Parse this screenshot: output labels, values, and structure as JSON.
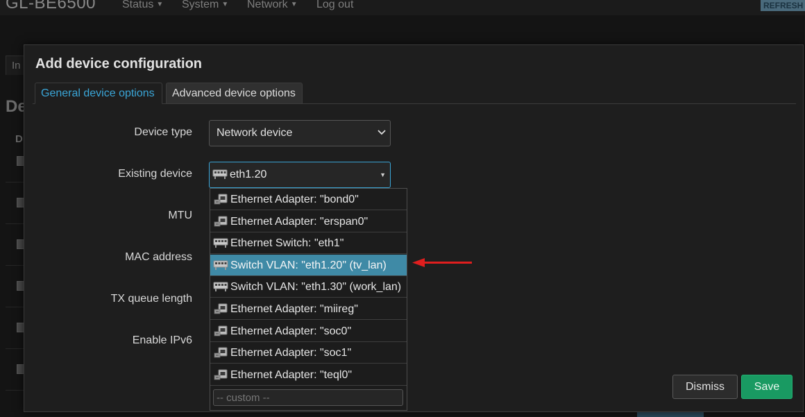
{
  "app": {
    "brand": "GL-BE6500",
    "nav": [
      "Status",
      "System",
      "Network",
      "Log out"
    ],
    "refresh_label": "REFRESH"
  },
  "background": {
    "tab_fragment": "In",
    "title_fragment": "De",
    "column_fragment": "D"
  },
  "modal": {
    "title": "Add device configuration",
    "tabs": [
      {
        "label": "General device options",
        "active": true
      },
      {
        "label": "Advanced device options",
        "active": false
      }
    ],
    "fields": {
      "device_type": {
        "label": "Device type",
        "value": "Network device"
      },
      "existing_device": {
        "label": "Existing device",
        "value": "eth1.20"
      },
      "mtu": {
        "label": "MTU"
      },
      "mac_address": {
        "label": "MAC address"
      },
      "tx_queue_length": {
        "label": "TX queue length"
      },
      "enable_ipv6": {
        "label": "Enable IPv6"
      }
    },
    "dropdown": {
      "items": [
        {
          "label": "Ethernet Adapter: \"bond0\"",
          "icon": "ethernet-adapter-icon"
        },
        {
          "label": "Ethernet Adapter: \"erspan0\"",
          "icon": "ethernet-adapter-icon"
        },
        {
          "label": "Ethernet Switch: \"eth1\"",
          "icon": "switch-icon"
        },
        {
          "label": "Switch VLAN: \"eth1.20\" (tv_lan)",
          "icon": "switch-icon",
          "selected": true
        },
        {
          "label": "Switch VLAN: \"eth1.30\" (work_lan)",
          "icon": "switch-icon"
        },
        {
          "label": "Ethernet Adapter: \"miireg\"",
          "icon": "ethernet-adapter-icon"
        },
        {
          "label": "Ethernet Adapter: \"soc0\"",
          "icon": "ethernet-adapter-icon"
        },
        {
          "label": "Ethernet Adapter: \"soc1\"",
          "icon": "ethernet-adapter-icon"
        },
        {
          "label": "Ethernet Adapter: \"teql0\"",
          "icon": "ethernet-adapter-icon"
        }
      ],
      "custom_placeholder": "-- custom --"
    },
    "buttons": {
      "dismiss": "Dismiss",
      "save": "Save"
    }
  },
  "colors": {
    "accent": "#3aa6d8",
    "selected_row": "#3f8aa6",
    "save": "#199a62",
    "arrow": "#e01e1e"
  }
}
